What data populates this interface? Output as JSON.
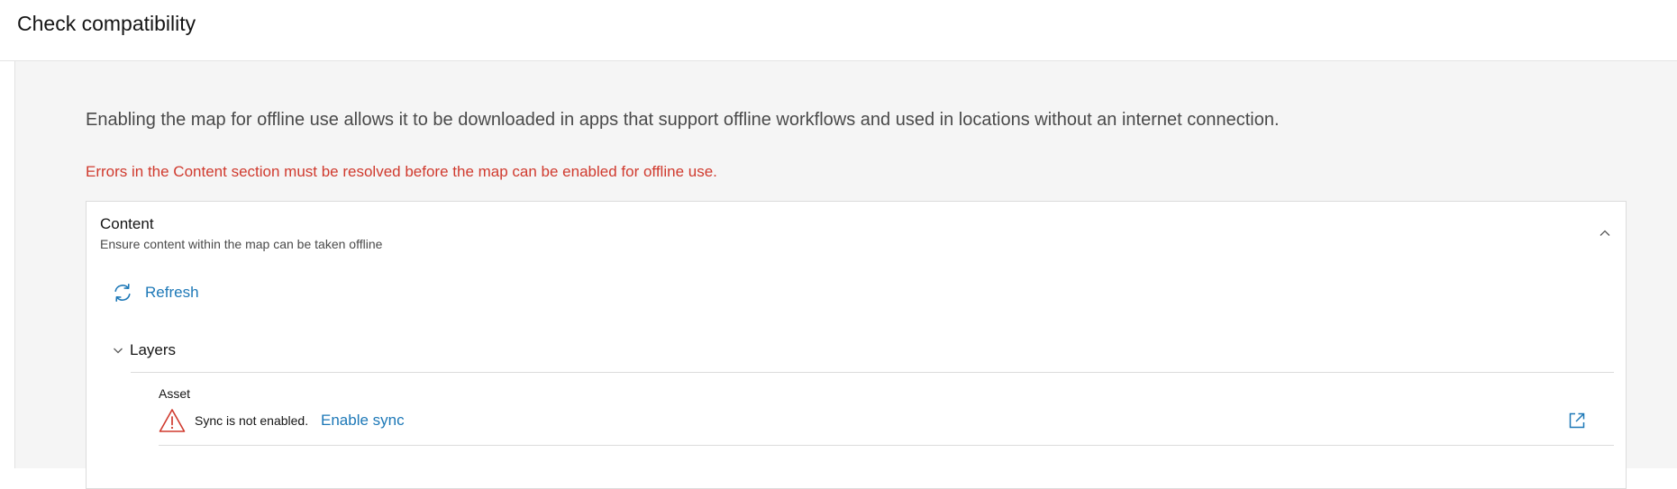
{
  "header": {
    "title": "Check compatibility"
  },
  "intro": {
    "text": "Enabling the map for offline use allows it to be downloaded in apps that support offline workflows and used in locations without an internet connection."
  },
  "error": {
    "text": "Errors in the Content section must be resolved before the map can be enabled for offline use.",
    "color": "#d03a2e"
  },
  "content_panel": {
    "title": "Content",
    "subtitle": "Ensure content within the map can be taken offline",
    "collapse_icon": "chevron-up-icon",
    "refresh_label": "Refresh",
    "refresh_icon": "refresh-icon",
    "layers": {
      "label": "Layers",
      "toggle_icon": "chevron-down-icon",
      "items": [
        {
          "name": "Asset",
          "status_icon": "warning-icon",
          "status": "Sync is not enabled.",
          "action_label": "Enable sync",
          "open_icon": "external-link-icon"
        }
      ]
    }
  },
  "colors": {
    "accent": "#1d78b7",
    "error": "#d03a2e",
    "background": "#f5f5f5"
  }
}
